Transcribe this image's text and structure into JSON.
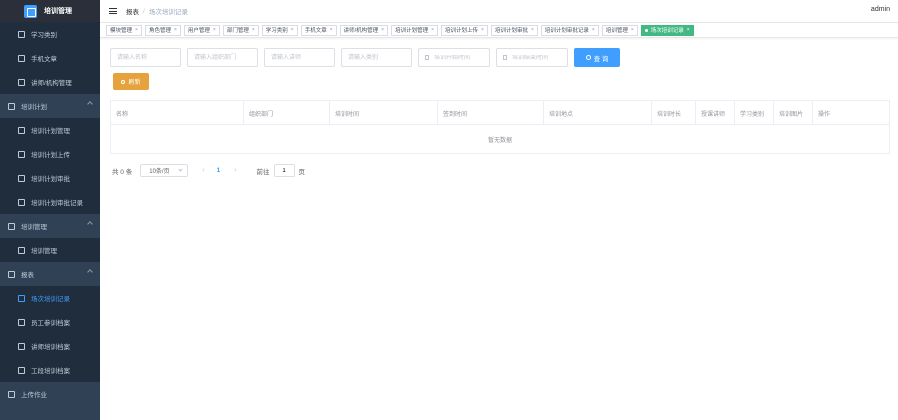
{
  "app": {
    "title": "培训管理"
  },
  "sidebar": {
    "items": [
      {
        "label": "学习类别",
        "kind": "child",
        "icon": "document-icon"
      },
      {
        "label": "手机文章",
        "kind": "child",
        "icon": "notebook-icon"
      },
      {
        "label": "讲师/机构管理",
        "kind": "child",
        "icon": "folder-icon"
      },
      {
        "label": "培训计划",
        "kind": "group",
        "icon": "clock-icon"
      },
      {
        "label": "培训计划管理",
        "kind": "child",
        "icon": "check-square-icon"
      },
      {
        "label": "培训计划上传",
        "kind": "child",
        "icon": "mail-icon"
      },
      {
        "label": "培训计划审批",
        "kind": "child",
        "icon": "edit-icon"
      },
      {
        "label": "培训计划审批记录",
        "kind": "child",
        "icon": "document-icon"
      },
      {
        "label": "培训管理",
        "kind": "group",
        "icon": "card-icon"
      },
      {
        "label": "培训管理",
        "kind": "child",
        "icon": "window-icon"
      },
      {
        "label": "报表",
        "kind": "group",
        "icon": "chart-icon"
      },
      {
        "label": "场次培训记录",
        "kind": "child",
        "icon": "line-chart-icon",
        "active": true
      },
      {
        "label": "员工参训档案",
        "kind": "child",
        "icon": "user-icon"
      },
      {
        "label": "讲师培训档案",
        "kind": "child",
        "icon": "window-icon"
      },
      {
        "label": "工段培训档案",
        "kind": "child",
        "icon": "monitor-icon"
      },
      {
        "label": "上传作业",
        "kind": "group",
        "icon": "gear-icon"
      }
    ]
  },
  "header": {
    "breadcrumb": [
      "报表",
      "场次培训记录"
    ],
    "user": "admin"
  },
  "tags": [
    {
      "label": "模块管理"
    },
    {
      "label": "角色管理"
    },
    {
      "label": "用户管理"
    },
    {
      "label": "部门管理"
    },
    {
      "label": "学习类别"
    },
    {
      "label": "手机文章"
    },
    {
      "label": "讲师/机构管理"
    },
    {
      "label": "培训计划管理"
    },
    {
      "label": "培训计划上传"
    },
    {
      "label": "培训计划审批"
    },
    {
      "label": "培训计划审批记录"
    },
    {
      "label": "培训管理"
    },
    {
      "label": "场次培训记录",
      "active": true
    }
  ],
  "filters": {
    "name_placeholder": "请输入名称",
    "dept_placeholder": "请输入组织部门",
    "lecturer_placeholder": "请输入讲师",
    "category_placeholder": "请输入类别",
    "start_placeholder": "培训开始时间",
    "end_placeholder": "培训结束时间",
    "search_label": "查 询",
    "refresh_label": "刷新"
  },
  "table": {
    "columns": [
      "名称",
      "组织部门",
      "培训时间",
      "签到时间",
      "培训地点",
      "培训时长",
      "授课讲师",
      "学习类别",
      "培训图片",
      "操作"
    ],
    "empty_text": "暂无数据"
  },
  "pagination": {
    "total_text": "共 0 条",
    "page_size": "10条/页",
    "current_page": "1",
    "goto_label": "前往",
    "goto_value": "1",
    "page_unit": "页"
  },
  "colors": {
    "sidebar_bg": "#304156",
    "primary": "#409eff",
    "warning": "#e6a23c",
    "active_tag": "#42b983"
  }
}
